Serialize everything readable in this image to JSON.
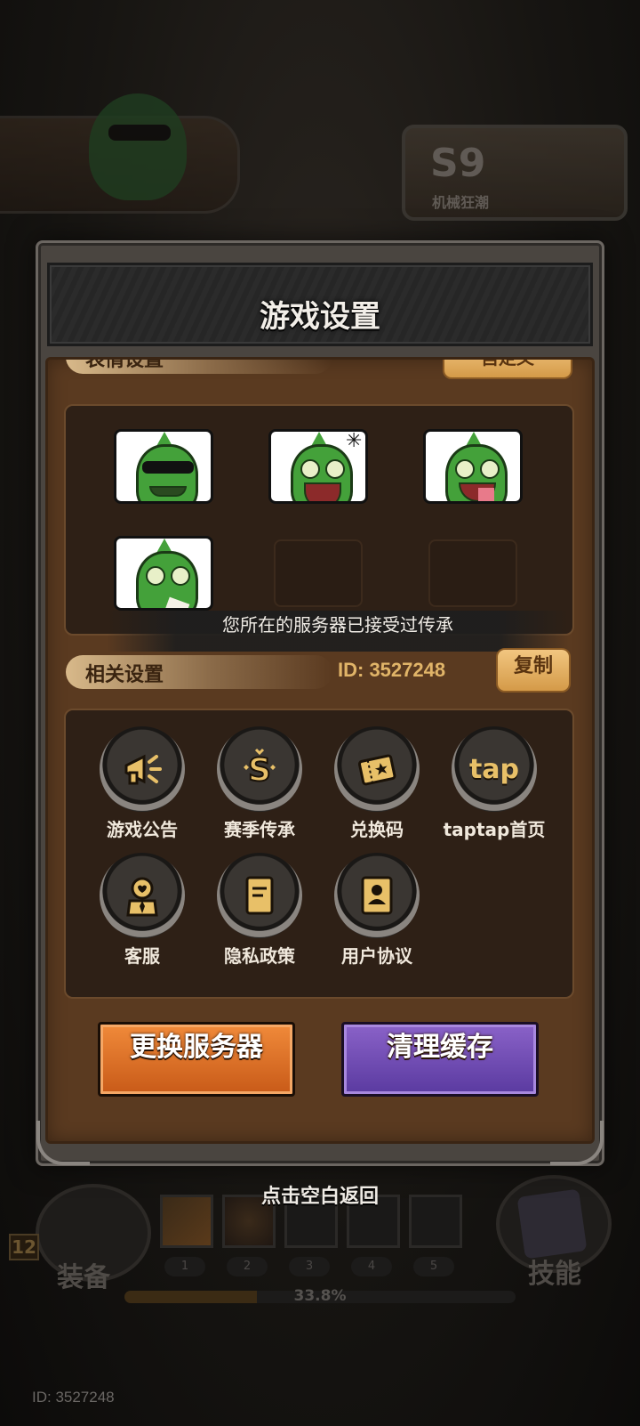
{
  "background": {
    "season": {
      "code": "S9",
      "name": "机械狂潮"
    },
    "bottom_nav": {
      "equipment_label": "装备",
      "skills_label": "技能",
      "level": "12",
      "slot_numbers": [
        "1",
        "2",
        "3",
        "4",
        "5"
      ],
      "xp_percent": "33.8%",
      "xp_fraction": 0.338
    },
    "footer_id": "ID: 3527248"
  },
  "panel": {
    "title": "游戏设置",
    "emoji_section": {
      "label": "表情设置",
      "custom_button": "自定义",
      "slots": [
        "cool-frog",
        "angry-frog",
        "tongue-frog",
        "crying-frog",
        "empty",
        "empty"
      ]
    },
    "toast": "您所在的服务器已接受过传承",
    "related_section": {
      "label": "相关设置",
      "id_text": "ID: 3527248",
      "copy_button": "复制"
    },
    "links": [
      {
        "label": "游戏公告",
        "icon": "megaphone-icon"
      },
      {
        "label": "赛季传承",
        "icon": "season-s-icon"
      },
      {
        "label": "兑换码",
        "icon": "ticket-icon"
      },
      {
        "label": "taptap首页",
        "icon": "tap-icon",
        "icon_text": "tap"
      },
      {
        "label": "客服",
        "icon": "customer-service-icon"
      },
      {
        "label": "隐私政策",
        "icon": "document-icon"
      },
      {
        "label": "用户协议",
        "icon": "user-card-icon"
      }
    ],
    "buttons": {
      "change_server": "更换服务器",
      "clear_cache": "清理缓存"
    }
  },
  "tap_to_return": "点击空白返回",
  "colors": {
    "accent_gold": "#e0b468",
    "orange_button": "#e0742a",
    "purple_button": "#7650b8",
    "panel_brown": "#5a3a20"
  }
}
